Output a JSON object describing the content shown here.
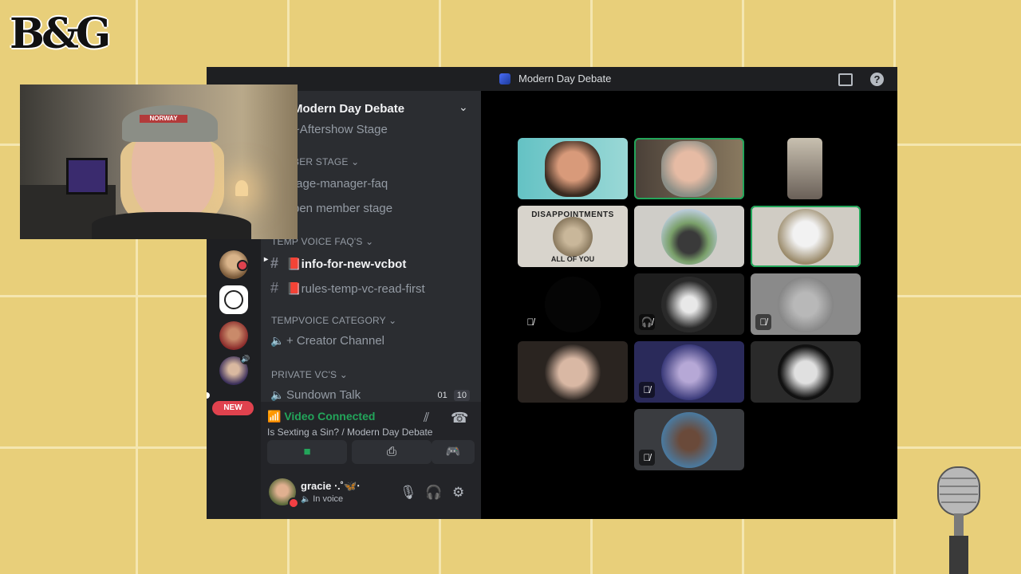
{
  "overlay": {
    "logo_text": "B&G",
    "webcam_hat_text": "NORWAY"
  },
  "window": {
    "title": "Modern Day Debate",
    "icons": {
      "inbox": "inbox-icon",
      "help": "help-icon",
      "help_glyph": "?"
    }
  },
  "guild_list": {
    "new_badge": "NEW",
    "speaker_glyph": "🔊"
  },
  "server": {
    "name": "Modern Day Debate",
    "chevron": "⌄",
    "channels": [
      {
        "type": "stage",
        "name": "Aftershow Stage",
        "prefix": "~"
      },
      {
        "type": "category",
        "name": "BER STAGE ⌄"
      },
      {
        "type": "text",
        "name": "tage-manager-faq"
      },
      {
        "type": "text",
        "name": "pen member stage"
      },
      {
        "type": "category",
        "name": "TEMP VOICE FAQ'S ⌄"
      },
      {
        "type": "text",
        "name": "📕info-for-new-vcbot",
        "active": true
      },
      {
        "type": "text",
        "name": "📕rules-temp-vc-read-first"
      },
      {
        "type": "category",
        "name": "TEMPVOICE CATEGORY ⌄"
      },
      {
        "type": "voice",
        "name": "+ Creator Channel"
      },
      {
        "type": "category",
        "name": "PRIVATE VC'S ⌄"
      },
      {
        "type": "voice",
        "name": "Sundown Talk",
        "count_a": "01",
        "count_b": "10"
      }
    ]
  },
  "voice_connection": {
    "status": "Video Connected",
    "channel": "Is Sexting a Sin? / Modern Day Debate",
    "buttons": [
      "camera-icon",
      "screen-share-icon",
      "activity-icon"
    ]
  },
  "user": {
    "name": "gracie ⋅.˚🦋⋅",
    "status": "In voice"
  },
  "stage": {
    "tiles": [
      {
        "name": "participant-1",
        "muted": false,
        "speaking": false
      },
      {
        "name": "participant-2",
        "muted": false,
        "speaking": true
      },
      {
        "name": "participant-3",
        "muted": false,
        "speaking": false
      },
      {
        "name": "participant-4",
        "muted": false,
        "speaking": false,
        "text_top": "DISAPPOINTMENTS",
        "text_bottom": "ALL OF YOU"
      },
      {
        "name": "participant-5",
        "muted": false,
        "speaking": false
      },
      {
        "name": "participant-6",
        "muted": false,
        "speaking": true
      },
      {
        "name": "participant-7",
        "muted": true,
        "speaking": false
      },
      {
        "name": "participant-8",
        "muted": true,
        "speaking": false
      },
      {
        "name": "participant-9",
        "muted": true,
        "speaking": false
      },
      {
        "name": "participant-10",
        "muted": false,
        "speaking": false
      },
      {
        "name": "participant-11",
        "muted": true,
        "speaking": false
      },
      {
        "name": "participant-12",
        "muted": false,
        "speaking": false
      },
      {
        "name": "participant-13",
        "muted": true,
        "speaking": false
      }
    ]
  },
  "colors": {
    "accent_green": "#23a55a",
    "background_yellow": "#e8cf7a",
    "badge_red": "#e0424e"
  }
}
